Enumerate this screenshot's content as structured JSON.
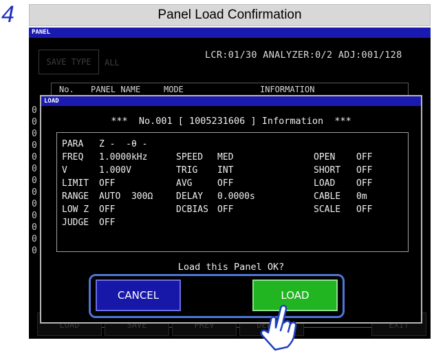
{
  "step_number": "4",
  "header_title": "Panel Load Confirmation",
  "screen": {
    "title": "PANEL",
    "save_type_label": "SAVE TYPE",
    "save_type_value": "ALL",
    "status": "LCR:01/30  ANALYZER:0/2  ADJ:001/128",
    "columns": [
      "No.",
      "PANEL NAME",
      "MODE",
      "INFORMATION"
    ],
    "row_markers": [
      "0",
      "0",
      "0",
      "0",
      "0",
      "0",
      "0",
      "0",
      "0",
      "0",
      "0",
      "0",
      "0"
    ],
    "bottom_buttons": [
      "LOAD",
      "SAVE",
      "PREV",
      "DELETE",
      "EXIT"
    ]
  },
  "dialog": {
    "title": "LOAD",
    "header": "***  No.001 [ 1005231606 ] Information  ***",
    "params": [
      {
        "label": "PARA",
        "value": "Z -  -θ -"
      },
      {
        "label": "FREQ",
        "value": "1.0000kHz"
      },
      {
        "label": "V",
        "value": "1.000V"
      },
      {
        "label": "LIMIT",
        "value": "OFF"
      },
      {
        "label": "RANGE",
        "value": "AUTO  300Ω"
      },
      {
        "label": "LOW Z",
        "value": "OFF"
      },
      {
        "label": "JUDGE",
        "value": "OFF"
      }
    ],
    "params_mid": [
      {
        "label": "SPEED",
        "value": "MED"
      },
      {
        "label": "TRIG",
        "value": "INT"
      },
      {
        "label": "AVG",
        "value": "OFF"
      },
      {
        "label": "DELAY",
        "value": "0.0000s"
      },
      {
        "label": "DCBIAS",
        "value": "OFF"
      }
    ],
    "params_right": [
      {
        "label": "OPEN",
        "value": "OFF"
      },
      {
        "label": "SHORT",
        "value": "OFF"
      },
      {
        "label": "LOAD",
        "value": "OFF"
      },
      {
        "label": "CABLE",
        "value": "0m"
      },
      {
        "label": "SCALE",
        "value": "OFF"
      }
    ],
    "prompt": "Load this Panel OK?",
    "cancel_label": "CANCEL",
    "load_label": "LOAD"
  },
  "colors": {
    "accent_blue": "#1a1ab0",
    "cancel_blue": "#1717a8",
    "load_green": "#22b522",
    "highlight_frame": "#4f77d8"
  },
  "icons": [
    "pointing-hand-icon"
  ]
}
